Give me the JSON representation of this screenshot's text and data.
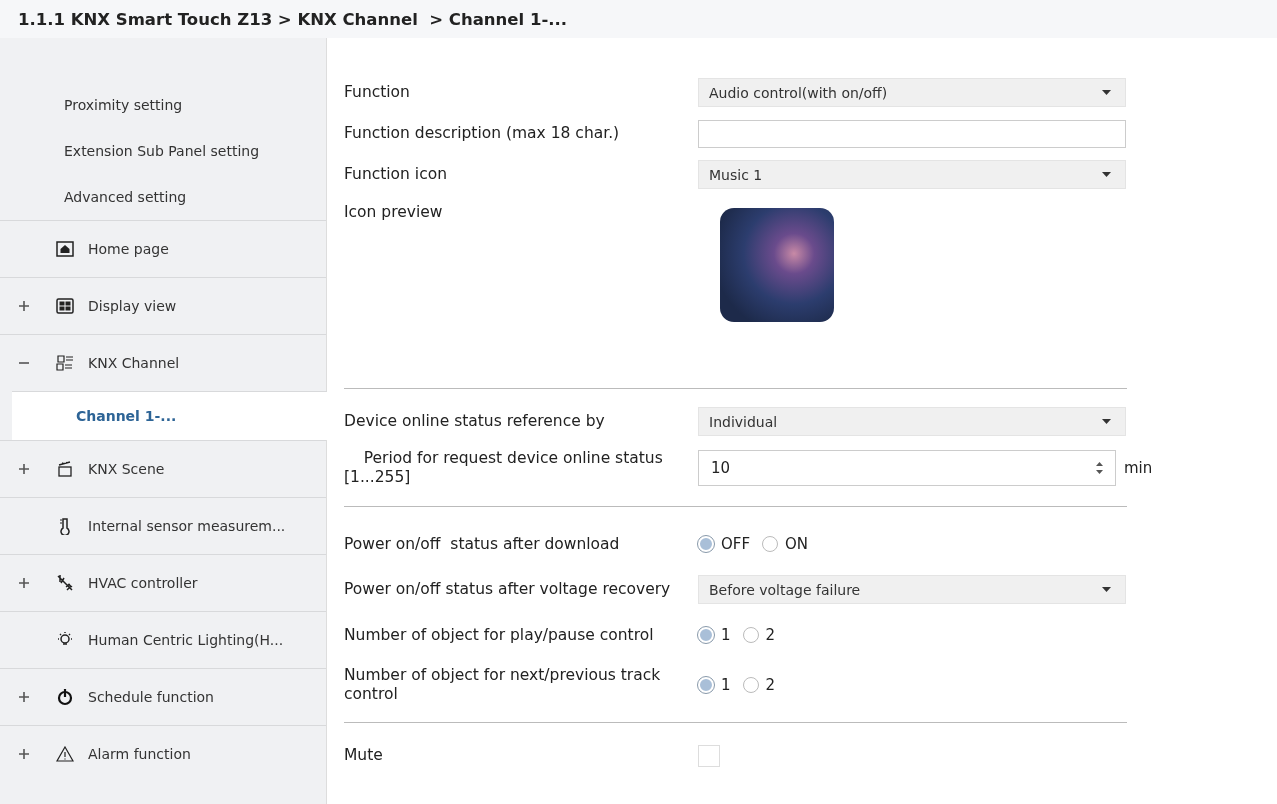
{
  "breadcrumb": "1.1.1 KNX Smart Touch Z13 > KNX Channel  > Channel 1-...",
  "sidebar": {
    "items": [
      {
        "label": "Proximity setting",
        "kind": "sub",
        "selected": false
      },
      {
        "label": "Extension Sub Panel setting",
        "kind": "sub",
        "selected": false
      },
      {
        "label": "Advanced setting",
        "kind": "sub",
        "selected": false
      },
      {
        "label": "Home page",
        "kind": "top",
        "selected": false
      },
      {
        "label": "Display view",
        "kind": "top",
        "expanded": false,
        "selected": false
      },
      {
        "label": "KNX Channel",
        "kind": "top",
        "expanded": true,
        "selected": false
      },
      {
        "label": "Channel 1-...",
        "kind": "child",
        "selected": true
      },
      {
        "label": "KNX Scene",
        "kind": "top",
        "expanded": false,
        "selected": false
      },
      {
        "label": "Internal sensor measurem...",
        "kind": "top",
        "selected": false
      },
      {
        "label": "HVAC controller",
        "kind": "top",
        "expanded": false,
        "selected": false
      },
      {
        "label": "Human Centric Lighting(H...",
        "kind": "top",
        "selected": false
      },
      {
        "label": "Schedule function",
        "kind": "top",
        "expanded": false,
        "selected": false
      },
      {
        "label": "Alarm function",
        "kind": "top",
        "expanded": false,
        "selected": false
      }
    ]
  },
  "settings": [
    {
      "kind": "select",
      "label": "Function",
      "value": "Audio control(with on/off)"
    },
    {
      "kind": "text",
      "label": "Function description (max 18 char.)"
    },
    {
      "kind": "select",
      "label": "Function icon",
      "value": "Music 1"
    },
    {
      "kind": "image",
      "label": "Icon preview"
    },
    {
      "kind": "divider"
    },
    {
      "kind": "select",
      "label": "Device online status reference by",
      "value": "Individual"
    },
    {
      "kind": "spinner",
      "label": "    Period for request device online status [1...255]",
      "value": "10",
      "unit": "min"
    },
    {
      "kind": "divider"
    },
    {
      "kind": "radio",
      "label": "Power on/off  status after download",
      "options": [
        {
          "label": "OFF",
          "selected": true
        },
        {
          "label": "ON",
          "selected": false
        }
      ]
    },
    {
      "kind": "select",
      "label": "Power on/off status after voltage recovery",
      "value": "Before voltage failure"
    },
    {
      "kind": "radio",
      "label": "Number of object for play/pause control",
      "options": [
        {
          "label": "1",
          "selected": true
        },
        {
          "label": "2",
          "selected": false
        }
      ]
    },
    {
      "kind": "radio",
      "label": "Number of object for next/previous track control",
      "options": [
        {
          "label": "1",
          "selected": true
        },
        {
          "label": "2",
          "selected": false
        }
      ]
    },
    {
      "kind": "divider"
    },
    {
      "kind": "checkbox",
      "label": "Mute",
      "checked": false
    }
  ]
}
